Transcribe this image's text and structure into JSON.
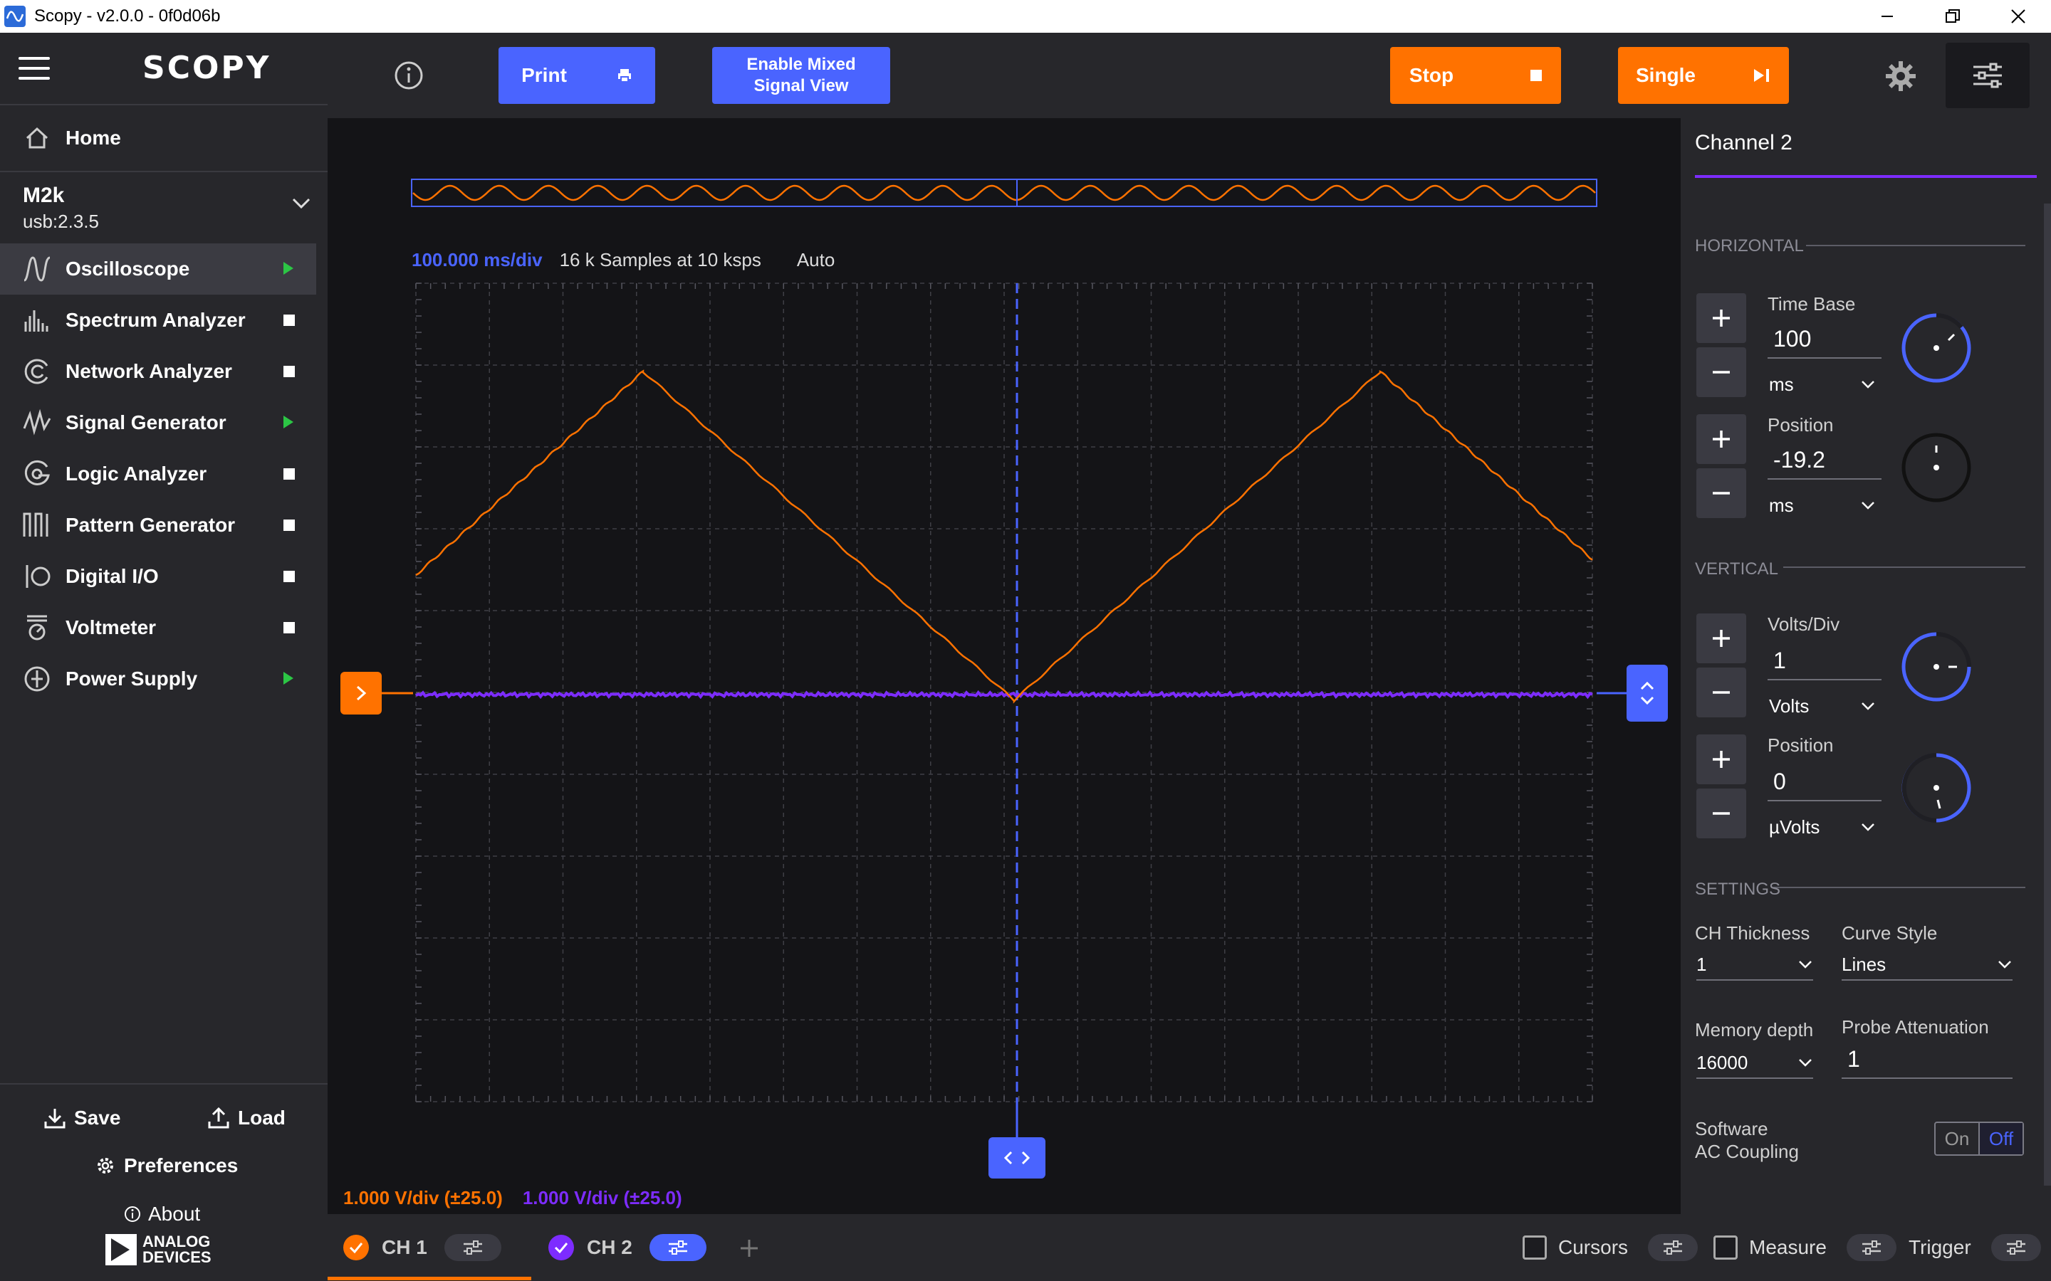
{
  "window": {
    "title": "Scopy - v2.0.0 - 0f0d06b"
  },
  "sidebar": {
    "logo": "SCOPY",
    "home": "Home",
    "device": {
      "name": "M2k",
      "uri": "usb:2.3.5"
    },
    "tools": [
      {
        "label": "Oscilloscope",
        "state": "running"
      },
      {
        "label": "Spectrum Analyzer",
        "state": "stopped"
      },
      {
        "label": "Network Analyzer",
        "state": "stopped"
      },
      {
        "label": "Signal Generator",
        "state": "running"
      },
      {
        "label": "Logic Analyzer",
        "state": "stopped"
      },
      {
        "label": "Pattern Generator",
        "state": "stopped"
      },
      {
        "label": "Digital I/O",
        "state": "stopped"
      },
      {
        "label": "Voltmeter",
        "state": "stopped"
      },
      {
        "label": "Power Supply",
        "state": "running"
      }
    ],
    "save": "Save",
    "load": "Load",
    "preferences": "Preferences",
    "about": "About",
    "vendor_line1": "ANALOG",
    "vendor_line2": "DEVICES"
  },
  "toolbar": {
    "print": "Print",
    "mixed_line1": "Enable Mixed",
    "mixed_line2": "Signal View",
    "stop": "Stop",
    "single": "Single"
  },
  "plot": {
    "timebase": "100.000 ms/div",
    "samples": "16 k Samples at 10 ksps",
    "trigger_mode": "Auto",
    "ch1_scale": "1.000 V/div (±25.0)",
    "ch2_scale": "1.000 V/div (±25.0)"
  },
  "panel": {
    "title": "Channel 2",
    "horizontal": "HORIZONTAL",
    "time_base_label": "Time Base",
    "time_base_value": "100",
    "time_base_unit": "ms",
    "h_position_label": "Position",
    "h_position_value": "-19.2",
    "h_position_unit": "ms",
    "vertical": "VERTICAL",
    "volts_div_label": "Volts/Div",
    "volts_div_value": "1",
    "volts_div_unit": "Volts",
    "v_position_label": "Position",
    "v_position_value": "0",
    "v_position_unit": "µVolts",
    "settings": "SETTINGS",
    "ch_thickness_label": "CH Thickness",
    "ch_thickness_value": "1",
    "curve_style_label": "Curve Style",
    "curve_style_value": "Lines",
    "memory_depth_label": "Memory depth",
    "memory_depth_value": "16000",
    "probe_att_label": "Probe Attenuation",
    "probe_att_value": "1",
    "sw_ac_line1": "Software",
    "sw_ac_line2": "AC Coupling",
    "on": "On",
    "off": "Off"
  },
  "chbar": {
    "ch1": "CH 1",
    "ch2": "CH 2",
    "cursors": "Cursors",
    "measure": "Measure",
    "trigger": "Trigger"
  },
  "colors": {
    "ch1": "#ff7200",
    "ch2": "#7d2cff",
    "accent_blue": "#4a64ff",
    "running_green": "#2cc645"
  }
}
